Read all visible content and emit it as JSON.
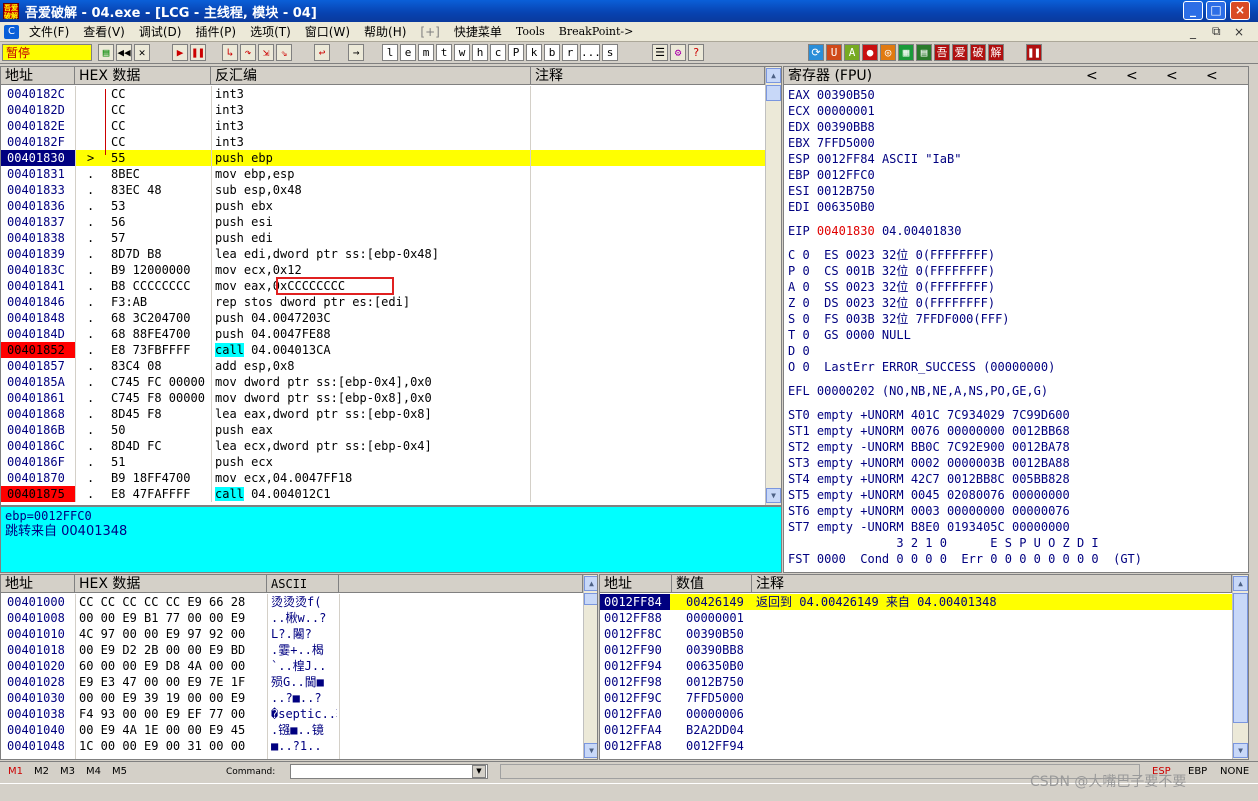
{
  "window": {
    "title": "吾爱破解 - 04.exe - [LCG - 主线程, 模块 - 04]",
    "min": "_",
    "max": "□",
    "close": "×"
  },
  "menu": {
    "items": [
      "文件(F)",
      "查看(V)",
      "调试(D)",
      "插件(P)",
      "选项(T)",
      "窗口(W)",
      "帮助(H)",
      "[+]",
      "快捷菜单",
      "Tools",
      "BreakPoint->"
    ],
    "right": [
      "_",
      "⧉",
      "×"
    ]
  },
  "toolbar": {
    "status": "暂停",
    "letters": [
      "l",
      "e",
      "m",
      "t",
      "w",
      "h",
      "c",
      "P",
      "k",
      "b",
      "r",
      "...",
      "s"
    ],
    "right_icons": [
      "吾",
      "爱",
      "破",
      "解"
    ]
  },
  "disasm": {
    "headers": [
      "地址",
      "HEX 数据",
      "反汇编",
      "注释"
    ],
    "rows": [
      {
        "addr": "0040182C",
        "mark": "",
        "hex": "CC",
        "asm": "int3",
        "state": "normal"
      },
      {
        "addr": "0040182D",
        "mark": "",
        "hex": "CC",
        "asm": "int3",
        "state": "normal"
      },
      {
        "addr": "0040182E",
        "mark": "",
        "hex": "CC",
        "asm": "int3",
        "state": "normal"
      },
      {
        "addr": "0040182F",
        "mark": "",
        "hex": "CC",
        "asm": "int3",
        "state": "normal"
      },
      {
        "addr": "00401830",
        "mark": ">",
        "hex": "55",
        "asm": "push ebp",
        "state": "current"
      },
      {
        "addr": "00401831",
        "mark": ".",
        "hex": "8BEC",
        "asm": "mov ebp,esp",
        "state": "normal"
      },
      {
        "addr": "00401833",
        "mark": ".",
        "hex": "83EC 48",
        "asm": "sub esp,0x48",
        "state": "normal"
      },
      {
        "addr": "00401836",
        "mark": ".",
        "hex": "53",
        "asm": "push ebx",
        "state": "normal"
      },
      {
        "addr": "00401837",
        "mark": ".",
        "hex": "56",
        "asm": "push esi",
        "state": "normal"
      },
      {
        "addr": "00401838",
        "mark": ".",
        "hex": "57",
        "asm": "push edi",
        "state": "normal"
      },
      {
        "addr": "00401839",
        "mark": ".",
        "hex": "8D7D B8",
        "asm": "lea edi,dword ptr ss:[ebp-0x48]",
        "state": "normal"
      },
      {
        "addr": "0040183C",
        "mark": ".",
        "hex": "B9 12000000",
        "asm": "mov ecx,0x12",
        "state": "normal"
      },
      {
        "addr": "00401841",
        "mark": ".",
        "hex": "B8 CCCCCCCC",
        "asm": "mov eax,0xCCCCCCCC",
        "state": "boxed"
      },
      {
        "addr": "00401846",
        "mark": ".",
        "hex": "F3:AB",
        "asm": "rep stos dword ptr es:[edi]",
        "state": "normal"
      },
      {
        "addr": "00401848",
        "mark": ".",
        "hex": "68 3C204700",
        "asm": "push 04.0047203C",
        "state": "normal"
      },
      {
        "addr": "0040184D",
        "mark": ".",
        "hex": "68 88FE4700",
        "asm": "push 04.0047FE88",
        "state": "normal"
      },
      {
        "addr": "00401852",
        "mark": ".",
        "hex": "E8 73FBFFFF",
        "asm": "call 04.004013CA",
        "state": "breakpoint"
      },
      {
        "addr": "00401857",
        "mark": ".",
        "hex": "83C4 08",
        "asm": "add esp,0x8",
        "state": "normal"
      },
      {
        "addr": "0040185A",
        "mark": ".",
        "hex": "C745 FC 00000",
        "asm": "mov dword ptr ss:[ebp-0x4],0x0",
        "state": "normal"
      },
      {
        "addr": "00401861",
        "mark": ".",
        "hex": "C745 F8 00000",
        "asm": "mov dword ptr ss:[ebp-0x8],0x0",
        "state": "normal"
      },
      {
        "addr": "00401868",
        "mark": ".",
        "hex": "8D45 F8",
        "asm": "lea eax,dword ptr ss:[ebp-0x8]",
        "state": "normal"
      },
      {
        "addr": "0040186B",
        "mark": ".",
        "hex": "50",
        "asm": "push eax",
        "state": "normal"
      },
      {
        "addr": "0040186C",
        "mark": ".",
        "hex": "8D4D FC",
        "asm": "lea ecx,dword ptr ss:[ebp-0x4]",
        "state": "normal"
      },
      {
        "addr": "0040186F",
        "mark": ".",
        "hex": "51",
        "asm": "push ecx",
        "state": "normal"
      },
      {
        "addr": "00401870",
        "mark": ".",
        "hex": "B9 18FF4700",
        "asm": "mov ecx,04.0047FF18",
        "state": "normal"
      },
      {
        "addr": "00401875",
        "mark": ".",
        "hex": "E8 47FAFFFF",
        "asm": "call 04.004012C1",
        "state": "breakpoint"
      }
    ]
  },
  "info": {
    "line1": "ebp=0012FFC0",
    "line2": "跳转来自 00401348"
  },
  "registers": {
    "header": "寄存器 (FPU)",
    "nav": [
      "<",
      "<",
      "<",
      "<"
    ],
    "gp": [
      {
        "name": "EAX",
        "value": "00390B50",
        "comment": ""
      },
      {
        "name": "ECX",
        "value": "00000001",
        "comment": ""
      },
      {
        "name": "EDX",
        "value": "00390BB8",
        "comment": ""
      },
      {
        "name": "EBX",
        "value": "7FFD5000",
        "comment": ""
      },
      {
        "name": "ESP",
        "value": "0012FF84",
        "comment": "ASCII \"IaB\""
      },
      {
        "name": "EBP",
        "value": "0012FFC0",
        "comment": ""
      },
      {
        "name": "ESI",
        "value": "0012B750",
        "comment": ""
      },
      {
        "name": "EDI",
        "value": "006350B0",
        "comment": ""
      }
    ],
    "eip": {
      "name": "EIP",
      "value": "00401830",
      "comment": "04.00401830"
    },
    "flags": [
      "C 0  ES 0023 32位 0(FFFFFFFF)",
      "P 0  CS 001B 32位 0(FFFFFFFF)",
      "A 0  SS 0023 32位 0(FFFFFFFF)",
      "Z 0  DS 0023 32位 0(FFFFFFFF)",
      "S 0  FS 003B 32位 7FFDF000(FFF)",
      "T 0  GS 0000 NULL",
      "D 0",
      "O 0  LastErr ERROR_SUCCESS (00000000)"
    ],
    "efl": "EFL 00000202 (NO,NB,NE,A,NS,PO,GE,G)",
    "fpu": [
      "ST0 empty +UNORM 401C 7C934029 7C99D600",
      "ST1 empty +UNORM 0076 00000000 0012BB68",
      "ST2 empty -UNORM BB0C 7C92E900 0012BA78",
      "ST3 empty +UNORM 0002 0000003B 0012BA88",
      "ST4 empty +UNORM 42C7 0012BB8C 005BB828",
      "ST5 empty +UNORM 0045 02080076 00000000",
      "ST6 empty +UNORM 0003 00000000 00000076",
      "ST7 empty -UNORM B8E0 0193405C 00000000"
    ],
    "fpu_hdr": "               3 2 1 0      E S P U O Z D I",
    "fst": "FST 0000  Cond 0 0 0 0  Err 0 0 0 0 0 0 0 0  (GT)"
  },
  "dump": {
    "headers": [
      "地址",
      "HEX 数据",
      "ASCII"
    ],
    "rows": [
      {
        "addr": "00401000",
        "hex": "CC CC CC CC CC E9 66 28",
        "ascii": "烫烫烫f("
      },
      {
        "addr": "00401008",
        "hex": "00 00 E9 B1 77 00 00 E9",
        "ascii": "..楸w..?"
      },
      {
        "addr": "00401010",
        "hex": "4C 97 00 00 E9 97 92 00",
        "ascii": "L?.闂?"
      },
      {
        "addr": "00401018",
        "hex": "00 E9 D2 2B 00 00 E9 BD",
        "ascii": ".霎+..楬"
      },
      {
        "addr": "00401020",
        "hex": "60 00 00 E9 D8 4A 00 00",
        "ascii": "`..楻J.."
      },
      {
        "addr": "00401028",
        "hex": "E9 E3 47 00 00 E9 7E 1F",
        "ascii": "殒G..閫■"
      },
      {
        "addr": "00401030",
        "hex": "00 00 E9 39 19 00 00 E9",
        "ascii": "..?■..?"
      },
      {
        "addr": "00401038",
        "hex": "F4 93 00 00 E9 EF 77 00",
        "ascii": "�septic..轱w."
      },
      {
        "addr": "00401040",
        "hex": "00 E9 4A 1E 00 00 E9 45",
        "ascii": ".镪■..镜"
      },
      {
        "addr": "00401048",
        "hex": "1C 00 00 E9 00 31 00 00",
        "ascii": "■..?1.."
      }
    ]
  },
  "stack": {
    "headers": [
      "地址",
      "数值",
      "注释"
    ],
    "rows": [
      {
        "addr": "0012FF84",
        "value": "00426149",
        "comment": "返回到 04.00426149 来自 04.00401348",
        "current": true
      },
      {
        "addr": "0012FF88",
        "value": "00000001",
        "comment": "",
        "current": false
      },
      {
        "addr": "0012FF8C",
        "value": "00390B50",
        "comment": "",
        "current": false
      },
      {
        "addr": "0012FF90",
        "value": "00390BB8",
        "comment": "",
        "current": false
      },
      {
        "addr": "0012FF94",
        "value": "006350B0",
        "comment": "",
        "current": false
      },
      {
        "addr": "0012FF98",
        "value": "0012B750",
        "comment": "",
        "current": false
      },
      {
        "addr": "0012FF9C",
        "value": "7FFD5000",
        "comment": "",
        "current": false
      },
      {
        "addr": "0012FFA0",
        "value": "00000006",
        "comment": "",
        "current": false
      },
      {
        "addr": "0012FFA4",
        "value": "B2A2DD04",
        "comment": "",
        "current": false
      },
      {
        "addr": "0012FFA8",
        "value": "0012FF94",
        "comment": "",
        "current": false
      }
    ]
  },
  "bottom": {
    "mtabs": [
      "M1",
      "M2",
      "M3",
      "M4",
      "M5"
    ],
    "command_label": "Command:",
    "command_value": "",
    "esp": "ESP",
    "ebp": "EBP",
    "none": "NONE"
  },
  "watermark": "CSDN @大嘴巴子要不要"
}
